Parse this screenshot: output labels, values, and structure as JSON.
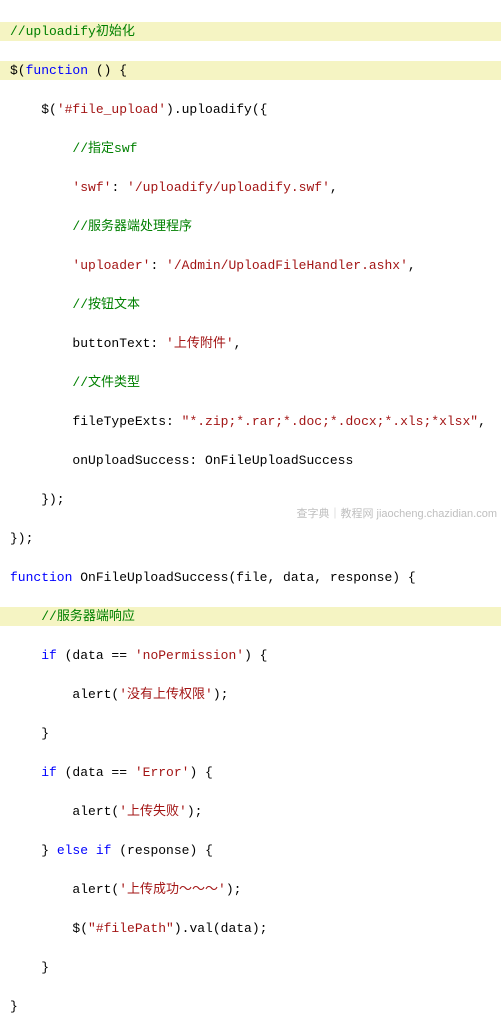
{
  "code": {
    "l1_a": "//uploadify初始化",
    "l2_a": "$(",
    "l2_b": "function",
    "l2_c": " () {",
    "l3_a": "    $(",
    "l3_b": "'#file_upload'",
    "l3_c": ").uploadify({",
    "l4_a": "        ",
    "l4_b": "//指定swf",
    "l5_a": "        ",
    "l5_b": "'swf'",
    "l5_c": ": ",
    "l5_d": "'/uploadify/uploadify.swf'",
    "l5_e": ",",
    "l6_a": "        ",
    "l6_b": "//服务器端处理程序",
    "l7_a": "        ",
    "l7_b": "'uploader'",
    "l7_c": ": ",
    "l7_d": "'/Admin/UploadFileHandler.ashx'",
    "l7_e": ",",
    "l8_a": "        ",
    "l8_b": "//按钮文本",
    "l9_a": "        buttonText: ",
    "l9_b": "'上传附件'",
    "l9_c": ",",
    "l10_a": "        ",
    "l10_b": "//文件类型",
    "l11_a": "        fileTypeExts: ",
    "l11_b": "\"*.zip;*.rar;*.doc;*.docx;*.xls;*xlsx\"",
    "l11_c": ",",
    "l12_a": "        onUploadSuccess: OnFileUploadSuccess",
    "l13_a": "    });",
    "l14_a": "});",
    "l15_a": "function",
    "l15_b": " OnFileUploadSuccess(file, data, response) {",
    "l16_a": "    ",
    "l16_b": "//服务器端响应",
    "l17_a": "    ",
    "l17_b": "if",
    "l17_c": " (data == ",
    "l17_d": "'noPermission'",
    "l17_e": ") {",
    "l18_a": "        alert(",
    "l18_b": "'没有上传权限'",
    "l18_c": ");",
    "l19_a": "    }",
    "l20_a": "    ",
    "l20_b": "if",
    "l20_c": " (data == ",
    "l20_d": "'Error'",
    "l20_e": ") {",
    "l21_a": "        alert(",
    "l21_b": "'上传失败'",
    "l21_c": ");",
    "l22_a": "    } ",
    "l22_b": "else",
    "l22_c": " ",
    "l22_d": "if",
    "l22_e": " (response) {",
    "l23_a": "        alert(",
    "l23_b": "'上传成功～～～'",
    "l23_c": ");",
    "l24_a": "        $(",
    "l24_b": "\"#filePath\"",
    "l24_c": ").val(data);",
    "l25_a": "    }",
    "l26_a": "}"
  },
  "watermark": "查字典｜教程网  jiaocheng.chazidian.com"
}
